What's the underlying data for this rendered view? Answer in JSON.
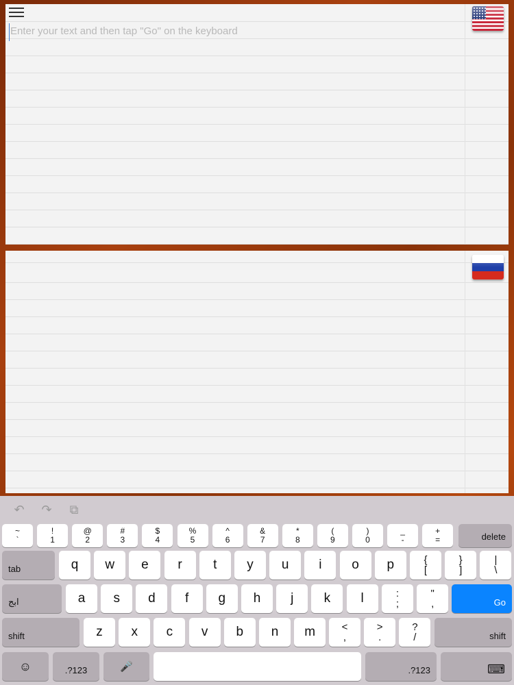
{
  "input": {
    "placeholder": "Enter your text and then tap \"Go\" on the keyboard",
    "value": ""
  },
  "icons": {
    "menu": "hamburger-menu-icon",
    "source_flag": "us-flag-icon",
    "target_flag": "russia-flag-icon"
  },
  "toolbar": {
    "undo": "↶",
    "redo": "↷",
    "paste": "⧉"
  },
  "keyboard": {
    "number_row": [
      {
        "top": "~",
        "bottom": "`"
      },
      {
        "top": "!",
        "bottom": "1"
      },
      {
        "top": "@",
        "bottom": "2"
      },
      {
        "top": "#",
        "bottom": "3"
      },
      {
        "top": "$",
        "bottom": "4"
      },
      {
        "top": "%",
        "bottom": "5"
      },
      {
        "top": "^",
        "bottom": "6"
      },
      {
        "top": "&",
        "bottom": "7"
      },
      {
        "top": "*",
        "bottom": "8"
      },
      {
        "top": "(",
        "bottom": "9"
      },
      {
        "top": ")",
        "bottom": "0"
      },
      {
        "top": "_",
        "bottom": "-"
      },
      {
        "top": "+",
        "bottom": "="
      }
    ],
    "delete": "delete",
    "tab": "tab",
    "row_q": [
      "q",
      "w",
      "e",
      "r",
      "t",
      "y",
      "u",
      "i",
      "o",
      "p"
    ],
    "row_q_syms": [
      {
        "top": "{",
        "bottom": "["
      },
      {
        "top": "}",
        "bottom": "]"
      },
      {
        "top": "|",
        "bottom": "\\"
      }
    ],
    "lang_switch": "ابج",
    "row_a": [
      "a",
      "s",
      "d",
      "f",
      "g",
      "h",
      "j",
      "k",
      "l"
    ],
    "row_a_syms": [
      {
        "top": ":",
        "bottom": ";"
      },
      {
        "top": "\"",
        "bottom": ","
      }
    ],
    "go": "Go",
    "shift": "shift",
    "row_z": [
      "z",
      "x",
      "c",
      "v",
      "b",
      "n",
      "m"
    ],
    "row_z_syms": [
      {
        "top": "<",
        "bottom": ","
      },
      {
        "top": ">",
        "bottom": "."
      },
      {
        "top": "?",
        "bottom": "/"
      }
    ],
    "emoji": "☺",
    "numbers": ".?123",
    "mic": "🎤",
    "space": "",
    "hide": "⌨"
  },
  "colors": {
    "go_key": "#0a84ff",
    "keyboard_bg": "#d1cbd0",
    "func_key": "#b4adb3"
  }
}
